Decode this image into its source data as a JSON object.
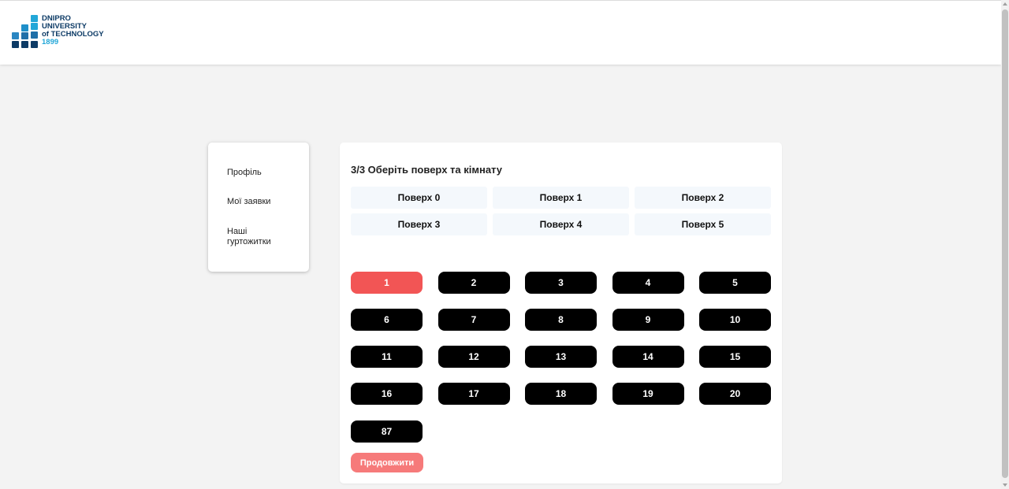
{
  "header": {
    "logo": {
      "line1": "DNIPRO",
      "line2": "UNIVERSITY",
      "line3": "of TECHNOLOGY",
      "line4": "1899",
      "colors": {
        "dark": "#0d3b66",
        "mid": "#1f6fa8",
        "light": "#22a7d8"
      }
    }
  },
  "sidebar": {
    "items": [
      {
        "label": "Профіль"
      },
      {
        "label": "Мої заявки"
      },
      {
        "label": "Наші гуртожитки"
      }
    ]
  },
  "main": {
    "step_title": "3/3 Оберіть поверх та кімнату",
    "floors": [
      {
        "label": "Поверх 0"
      },
      {
        "label": "Поверх 1"
      },
      {
        "label": "Поверх 2"
      },
      {
        "label": "Поверх 3"
      },
      {
        "label": "Поверх 4"
      },
      {
        "label": "Поверх 5"
      }
    ],
    "rooms": [
      {
        "label": "1",
        "selected": true
      },
      {
        "label": "2"
      },
      {
        "label": "3"
      },
      {
        "label": "4"
      },
      {
        "label": "5"
      },
      {
        "label": "6"
      },
      {
        "label": "7"
      },
      {
        "label": "8"
      },
      {
        "label": "9"
      },
      {
        "label": "10"
      },
      {
        "label": "11"
      },
      {
        "label": "12"
      },
      {
        "label": "13"
      },
      {
        "label": "14"
      },
      {
        "label": "15"
      },
      {
        "label": "16"
      },
      {
        "label": "17"
      },
      {
        "label": "18"
      },
      {
        "label": "19"
      },
      {
        "label": "20"
      },
      {
        "label": "87"
      }
    ],
    "continue_label": "Продовжити",
    "colors": {
      "selected_room": "#f25555",
      "room": "#000000",
      "continue": "#f67a7a"
    }
  }
}
